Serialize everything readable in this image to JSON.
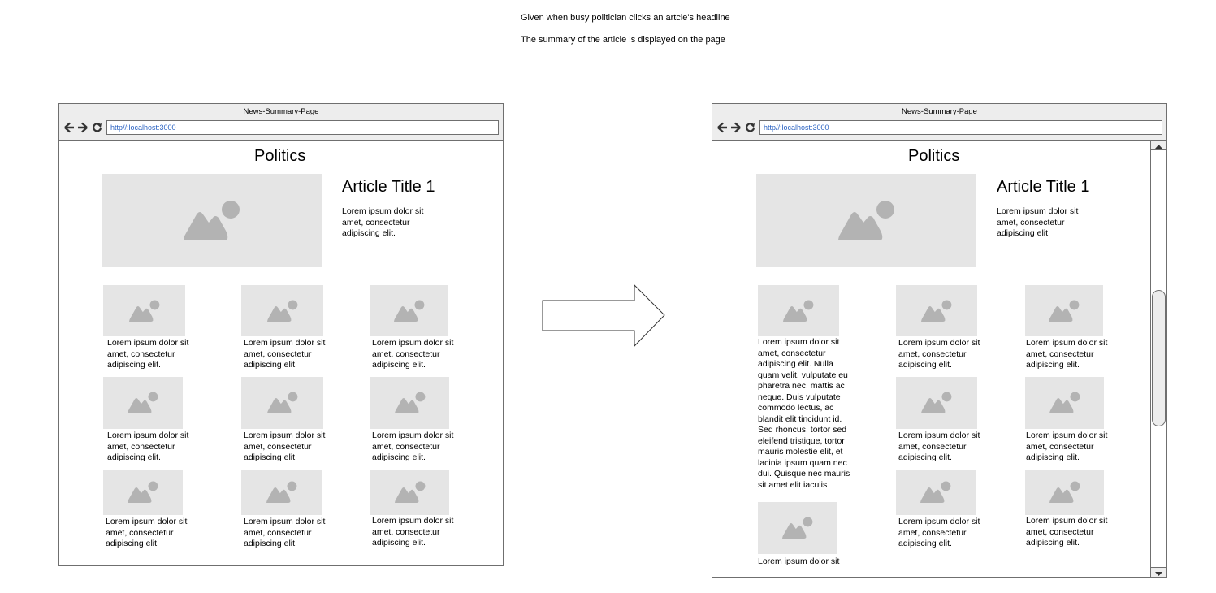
{
  "captions": {
    "given": "Given when busy politician clicks an artcle's headline",
    "then": "The summary of the article is displayed on the page"
  },
  "before": {
    "window_title": "News-Summary-Page",
    "url": "http//:localhost:3000",
    "section_title": "Politics",
    "article_title": "Article Title 1",
    "article_snippet": "Lorem ipsum dolor sit amet, consectetur adipiscing elit.",
    "card_text": "Lorem ipsum dolor sit amet, consectetur adipiscing elit."
  },
  "after": {
    "window_title": "News-Summary-Page",
    "url": "http//:localhost:3000",
    "section_title": "Politics",
    "article_title": "Article Title 1",
    "article_snippet": "Lorem ipsum dolor sit amet, consectetur adipiscing elit.",
    "expanded_summary": "Lorem ipsum dolor sit amet, consectetur adipiscing elit. Nulla quam velit, vulputate eu pharetra nec, mattis ac neque. Duis vulputate commodo lectus, ac blandit elit tincidunt id. Sed rhoncus, tortor sed eleifend tristique, tortor mauris molestie elit, et lacinia ipsum quam nec dui. Quisque nec mauris sit amet elit iaculis",
    "card_text": "Lorem ipsum dolor sit amet, consectetur adipiscing elit.",
    "partial_card_text": "Lorem ipsum dolor sit"
  },
  "icons": {
    "image_placeholder": "image-placeholder-icon",
    "back": "arrow-left-icon",
    "forward": "arrow-right-icon",
    "reload": "reload-icon",
    "transition": "block-arrow-right-icon"
  },
  "colors": {
    "placeholder_bg": "#e5e5e5",
    "placeholder_icon": "#b3b3b3",
    "chrome_bg": "#ededed",
    "border": "#6f6f6f",
    "url_text": "#2b63c2"
  }
}
